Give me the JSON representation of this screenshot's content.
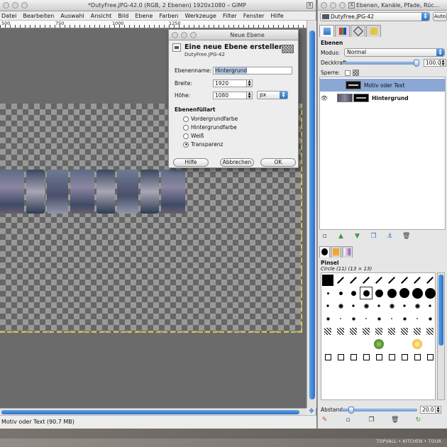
{
  "main_window": {
    "title": "*DutyFree.JPG-42.0 (RGB, 2 Ebenen) 1920x1080 – GIMP",
    "menu": [
      "Datei",
      "Bearbeiten",
      "Auswahl",
      "Ansicht",
      "Bild",
      "Ebene",
      "Farben",
      "Werkzeuge",
      "Filter",
      "Fenster",
      "Hilfe"
    ],
    "ruler_labels": [
      "500",
      "750",
      "1000",
      "1250"
    ],
    "status": "Motiv oder Text (90.7 MB)"
  },
  "dialog": {
    "title": "Neue Ebene",
    "heading": "Eine neue Ebene erstellen",
    "subheading": "DutyFree.JPG-42",
    "name_label": "Ebenenname:",
    "name_value": "Hintergrund",
    "width_label": "Breite:",
    "width_value": "1920",
    "height_label": "Höhe:",
    "height_value": "1080",
    "unit": "px",
    "fill_title": "Ebenenfüllart",
    "fill_options": [
      "Vordergrundfarbe",
      "Hintergrundfarbe",
      "Weiß",
      "Transparenz"
    ],
    "fill_selected": "Transparenz",
    "btn_help": "Hilfe",
    "btn_cancel": "Abbrechen",
    "btn_ok": "OK"
  },
  "dock": {
    "title": "Ebenen, Kanäle, Pfade, Rüc...",
    "image_select": "DutyFree.JPG-42",
    "auto_label": "Auto",
    "layers_title": "Ebenen",
    "mode_label": "Modus:",
    "mode_value": "Normal",
    "opacity_label": "Deckkraft:",
    "opacity_value": "100.0",
    "lock_label": "Sperre:",
    "layers": [
      {
        "name": "Motiv oder Text",
        "selected": true,
        "visible": false
      },
      {
        "name": "Hintergrund",
        "selected": false,
        "visible": true
      }
    ],
    "brushes_title": "Pinsel",
    "brush_current": "Circle (11) (13 × 13)",
    "spacing_label": "Abstand:",
    "spacing_value": "20.0"
  },
  "watermark": "TOPVALL • KITCHEN • TOUR",
  "colors": {
    "accent_blue": "#2f6fc4",
    "selection_row": "#8aa7d6",
    "marching_ants": "#d6c84a"
  },
  "icons": {
    "layer_buttons": [
      "new-layer-icon",
      "raise-layer-icon",
      "lower-layer-icon",
      "duplicate-layer-icon",
      "anchor-layer-icon",
      "delete-layer-icon"
    ],
    "brush_buttons": [
      "edit-brush-icon",
      "new-brush-icon",
      "duplicate-brush-icon",
      "delete-brush-icon",
      "refresh-brushes-icon"
    ]
  }
}
